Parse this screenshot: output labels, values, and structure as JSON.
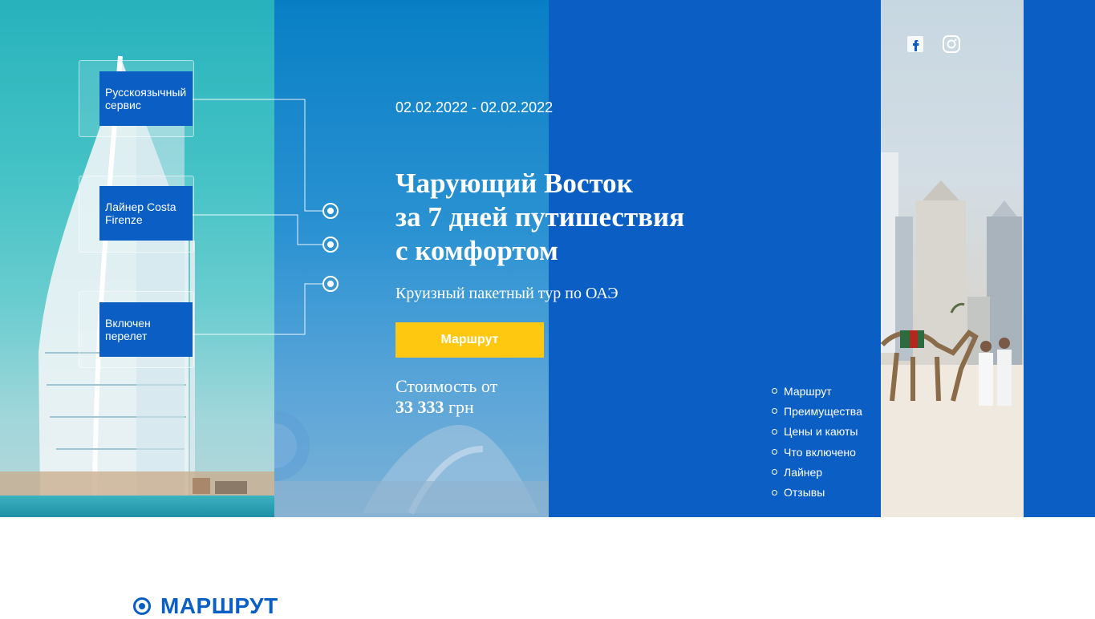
{
  "hero": {
    "features": [
      {
        "label": "Русскоязычный сервис"
      },
      {
        "label": "Лайнер Costa Firenze"
      },
      {
        "label": "Включен перелет"
      }
    ],
    "date_range": "02.02.2022 - 02.02.2022",
    "title_lines": [
      "Чарующий Восток",
      "за 7 дней путишествия",
      "с комфортом"
    ],
    "subtitle": "Круизный пакетный тур по ОАЭ",
    "cta_label": "Маршрут",
    "price_label": "Стоимость от",
    "price_amount": "33 333",
    "price_currency": "грн"
  },
  "social": [
    {
      "icon": "facebook-icon"
    },
    {
      "icon": "instagram-icon"
    }
  ],
  "side_nav": [
    {
      "label": "Маршрут"
    },
    {
      "label": "Преимущества"
    },
    {
      "label": "Цены и каюты"
    },
    {
      "label": "Что включено"
    },
    {
      "label": "Лайнер"
    },
    {
      "label": "Отзывы"
    }
  ],
  "section": {
    "title": "МАРШРУТ"
  },
  "colors": {
    "brand_blue": "#0a5ec4",
    "cta_yellow": "#fdc80f",
    "white": "#ffffff"
  }
}
